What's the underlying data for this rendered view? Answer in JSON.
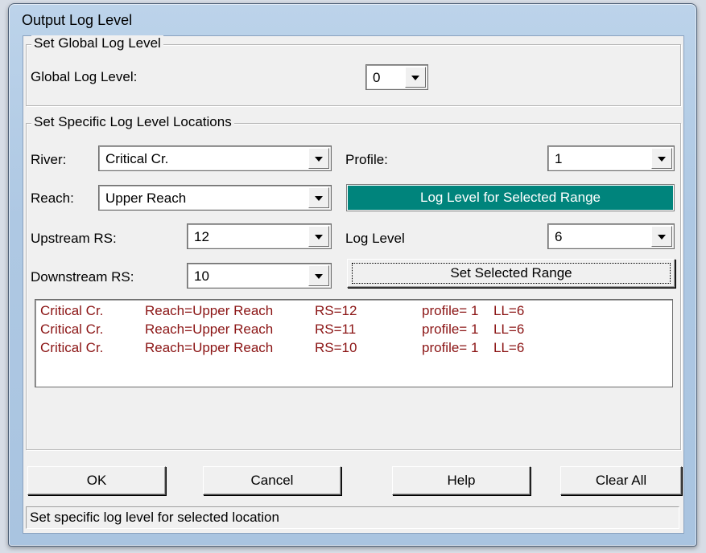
{
  "window": {
    "title": "Output Log Level"
  },
  "global_group": {
    "title": "Set Global Log Level",
    "label": "Global Log Level:",
    "value": "0"
  },
  "specific_group": {
    "title": "Set Specific Log Level Locations",
    "river_label": "River:",
    "river_value": "Critical Cr.",
    "reach_label": "Reach:",
    "reach_value": "Upper Reach",
    "upstream_label": "Upstream RS:",
    "upstream_value": "12",
    "downstream_label": "Downstream RS:",
    "downstream_value": "10",
    "profile_label": "Profile:",
    "profile_value": "1",
    "range_header": "Log Level for Selected Range",
    "log_level_label": "Log Level",
    "log_level_value": "6",
    "set_range_button": "Set Selected Range"
  },
  "locations_list": [
    {
      "river": "Critical Cr.",
      "reach": "Reach=Upper Reach",
      "rs": "RS=12",
      "profile": "profile= 1",
      "ll": "LL=6"
    },
    {
      "river": "Critical Cr.",
      "reach": "Reach=Upper Reach",
      "rs": "RS=11",
      "profile": "profile= 1",
      "ll": "LL=6"
    },
    {
      "river": "Critical Cr.",
      "reach": "Reach=Upper Reach",
      "rs": "RS=10",
      "profile": "profile= 1",
      "ll": "LL=6"
    }
  ],
  "buttons": {
    "ok": "OK",
    "cancel": "Cancel",
    "help": "Help",
    "clear_all": "Clear All"
  },
  "status": "Set specific log level for selected location",
  "colors": {
    "range_header_bg": "#00847c",
    "list_text": "#8b1414"
  }
}
